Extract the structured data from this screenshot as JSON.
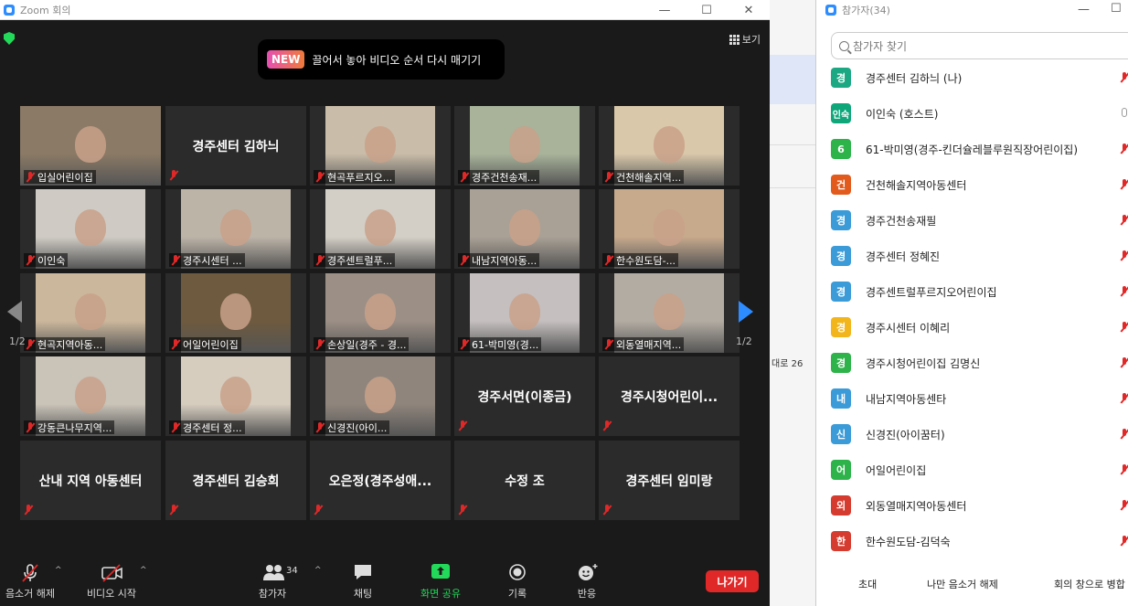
{
  "window": {
    "title": "Zoom 회의"
  },
  "view_button": "보기",
  "hint": {
    "badge": "NEW",
    "text": "끌어서 놓아 비디오 순서 다시 매기기"
  },
  "page_indicator": {
    "left": "1/2",
    "right": "1/2"
  },
  "tiles": [
    {
      "name": "입실어린이집",
      "video": true,
      "active": true,
      "bg": "#8b7a66"
    },
    {
      "name": "경주센터 김하늬",
      "video": false
    },
    {
      "name": "현곡푸르지오...",
      "video": true,
      "bg": "#c9bca8"
    },
    {
      "name": "경주건천송재...",
      "video": true,
      "bg": "#a8b39a"
    },
    {
      "name": "건천해솔지역...",
      "video": true,
      "bg": "#d9c8aa"
    },
    {
      "name": "이인숙",
      "video": true,
      "bg": "#cfcbc4"
    },
    {
      "name": "경주시센터 ...",
      "video": true,
      "bg": "#bdb4a8"
    },
    {
      "name": "경주센트럴푸...",
      "video": true,
      "bg": "#d4cfc6"
    },
    {
      "name": "내남지역아동...",
      "video": true,
      "bg": "#a9a196"
    },
    {
      "name": "한수원도담-...",
      "video": true,
      "bg": "#c7a98c"
    },
    {
      "name": "현곡지역아동...",
      "video": true,
      "bg": "#cbb79c"
    },
    {
      "name": "어일어린이집",
      "video": true,
      "bg": "#6e5a3e"
    },
    {
      "name": "손상일(경주 - 경...",
      "video": true,
      "bg": "#9c8f86"
    },
    {
      "name": "61-박미영(경...",
      "video": true,
      "bg": "#c5bfbf"
    },
    {
      "name": "외동열매지역...",
      "video": true,
      "bg": "#b3aca3"
    },
    {
      "name": "강동큰나무지역...",
      "video": true,
      "bg": "#c9c3b8"
    },
    {
      "name": "경주센터 정...",
      "video": true,
      "bg": "#d6cdbf"
    },
    {
      "name": "신경진(아이...",
      "video": true,
      "bg": "#8f857c"
    },
    {
      "name": "경주서면(이종금)",
      "video": false
    },
    {
      "name": "경주시청어린이...",
      "video": false
    },
    {
      "name": "산내 지역 아동센터",
      "video": false
    },
    {
      "name": "경주센터 김승희",
      "video": false
    },
    {
      "name": "오은정(경주성애...",
      "video": false
    },
    {
      "name": "수정 조",
      "video": false
    },
    {
      "name": "경주센터 임미랑",
      "video": false
    }
  ],
  "toolbar": {
    "unmute": "음소거 해제",
    "start_video": "비디오 시작",
    "participants": "참가자",
    "participants_count": "34",
    "chat": "채팅",
    "share": "화면 공유",
    "record": "기록",
    "reactions": "반응",
    "leave": "나가기"
  },
  "background_text": "대로 26",
  "panel": {
    "title": "참가자(34)",
    "search_placeholder": "참가자 찾기",
    "participants": [
      {
        "initial": "경",
        "name": "경주센터 김하늬 (나)",
        "color": "#1ca883",
        "muted": true
      },
      {
        "initial": "인숙",
        "name": "이인숙 (호스트)",
        "color": "#0fa77a",
        "muted": false
      },
      {
        "initial": "6",
        "name": "61-박미영(경주-킨더슐레블루원직장어린이집)",
        "color": "#2db34a",
        "muted": true
      },
      {
        "initial": "건",
        "name": "건천해솔지역아동센터",
        "color": "#e25a1c",
        "muted": true
      },
      {
        "initial": "경",
        "name": "경주건천송재필",
        "color": "#3b9bd8",
        "muted": true
      },
      {
        "initial": "경",
        "name": "경주센터 정혜진",
        "color": "#3b9bd8",
        "muted": true
      },
      {
        "initial": "경",
        "name": "경주센트럴푸르지오어린이집",
        "color": "#3b9bd8",
        "muted": true
      },
      {
        "initial": "경",
        "name": "경주시센터 이혜리",
        "color": "#f2b51b",
        "muted": true
      },
      {
        "initial": "경",
        "name": "경주시청어린이집 김명신",
        "color": "#2db34a",
        "muted": true
      },
      {
        "initial": "내",
        "name": "내남지역아동센타",
        "color": "#3b9bd8",
        "muted": true
      },
      {
        "initial": "신",
        "name": "신경진(아이꿈터)",
        "color": "#3b9bd8",
        "muted": true
      },
      {
        "initial": "어",
        "name": "어일어린이집",
        "color": "#2db34a",
        "muted": true
      },
      {
        "initial": "외",
        "name": "외동열매지역아동센터",
        "color": "#d63b2f",
        "muted": true
      },
      {
        "initial": "한",
        "name": "한수원도담-김덕숙",
        "color": "#d63b2f",
        "muted": true
      }
    ],
    "footer": {
      "invite": "초대",
      "unmute_me": "나만 음소거 해제",
      "merge": "회의 창으로 병합"
    }
  }
}
